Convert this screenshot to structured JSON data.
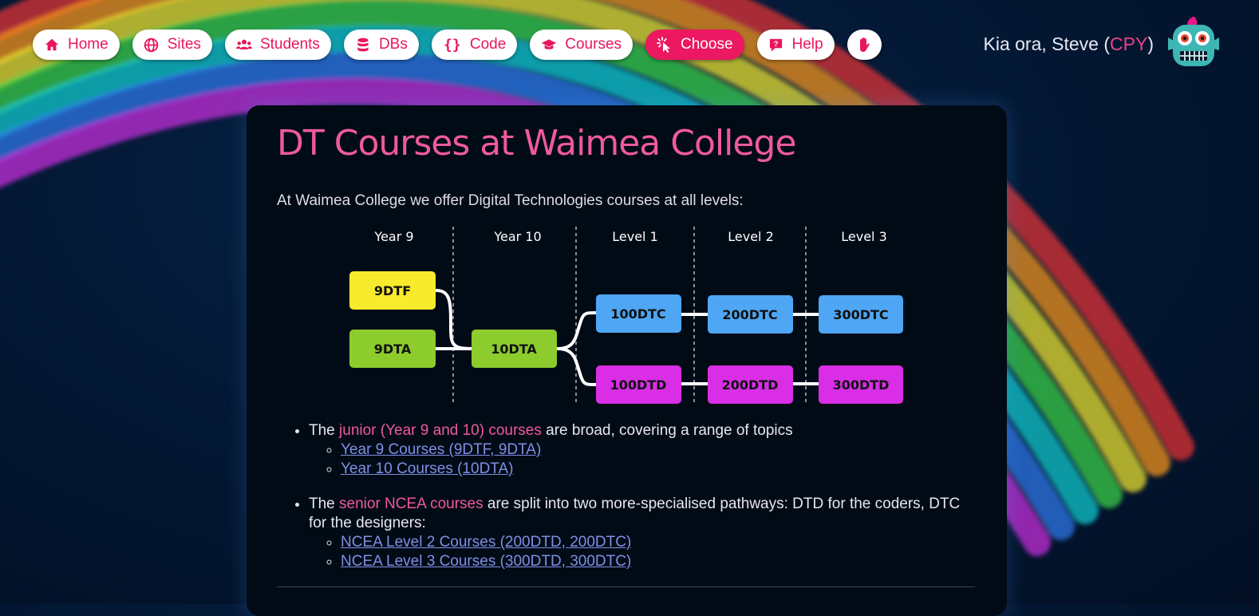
{
  "nav": {
    "items": [
      {
        "label": "Home",
        "icon": "home-icon"
      },
      {
        "label": "Sites",
        "icon": "globe-icon"
      },
      {
        "label": "Students",
        "icon": "users-icon"
      },
      {
        "label": "DBs",
        "icon": "database-icon"
      },
      {
        "label": "Code",
        "icon": "braces-icon"
      },
      {
        "label": "Courses",
        "icon": "graduation-cap-icon"
      },
      {
        "label": "Choose",
        "icon": "pointer-click-icon",
        "active": true
      },
      {
        "label": "Help",
        "icon": "help-bubble-icon"
      },
      {
        "label": "",
        "icon": "raised-hand-icon"
      }
    ]
  },
  "user": {
    "greeting_prefix": "Kia ora, Steve (",
    "class_code": "CPY",
    "greeting_suffix": ")"
  },
  "colors": {
    "accent": "#ec1862",
    "title": "#ee5a9b",
    "link": "#7f8fe6",
    "yellow": "#f8ea2c",
    "green": "#8ccc2c",
    "blue": "#4ea6f4",
    "magenta": "#d92de6"
  },
  "page": {
    "title": "DT Courses at Waimea College",
    "intro": "At Waimea College we offer Digital Technologies courses at all levels:"
  },
  "pathway": {
    "columns": [
      "Year 9",
      "Year 10",
      "Level 1",
      "Level 2",
      "Level 3"
    ],
    "courses": {
      "c9dtf": "9DTF",
      "c9dta": "9DTA",
      "c10dta": "10DTA",
      "c100dtc": "100DTC",
      "c200dtc": "200DTC",
      "c300dtc": "300DTC",
      "c100dtd": "100DTD",
      "c200dtd": "200DTD",
      "c300dtd": "300DTD"
    }
  },
  "junior": {
    "pre": "The ",
    "highlight": "junior (Year 9 and 10) courses",
    "post": " are broad, covering a range of topics",
    "links": [
      "Year 9 Courses (9DTF, 9DTA)",
      "Year 10 Courses (10DTA)"
    ]
  },
  "senior": {
    "pre": "The ",
    "highlight": "senior NCEA courses",
    "post": " are split into two more-specialised pathways: DTD for the coders, DTC for the designers:",
    "links": [
      "NCEA Level 2 Courses (200DTD, 200DTC)",
      "NCEA Level 3 Courses (300DTD, 300DTC)"
    ]
  }
}
